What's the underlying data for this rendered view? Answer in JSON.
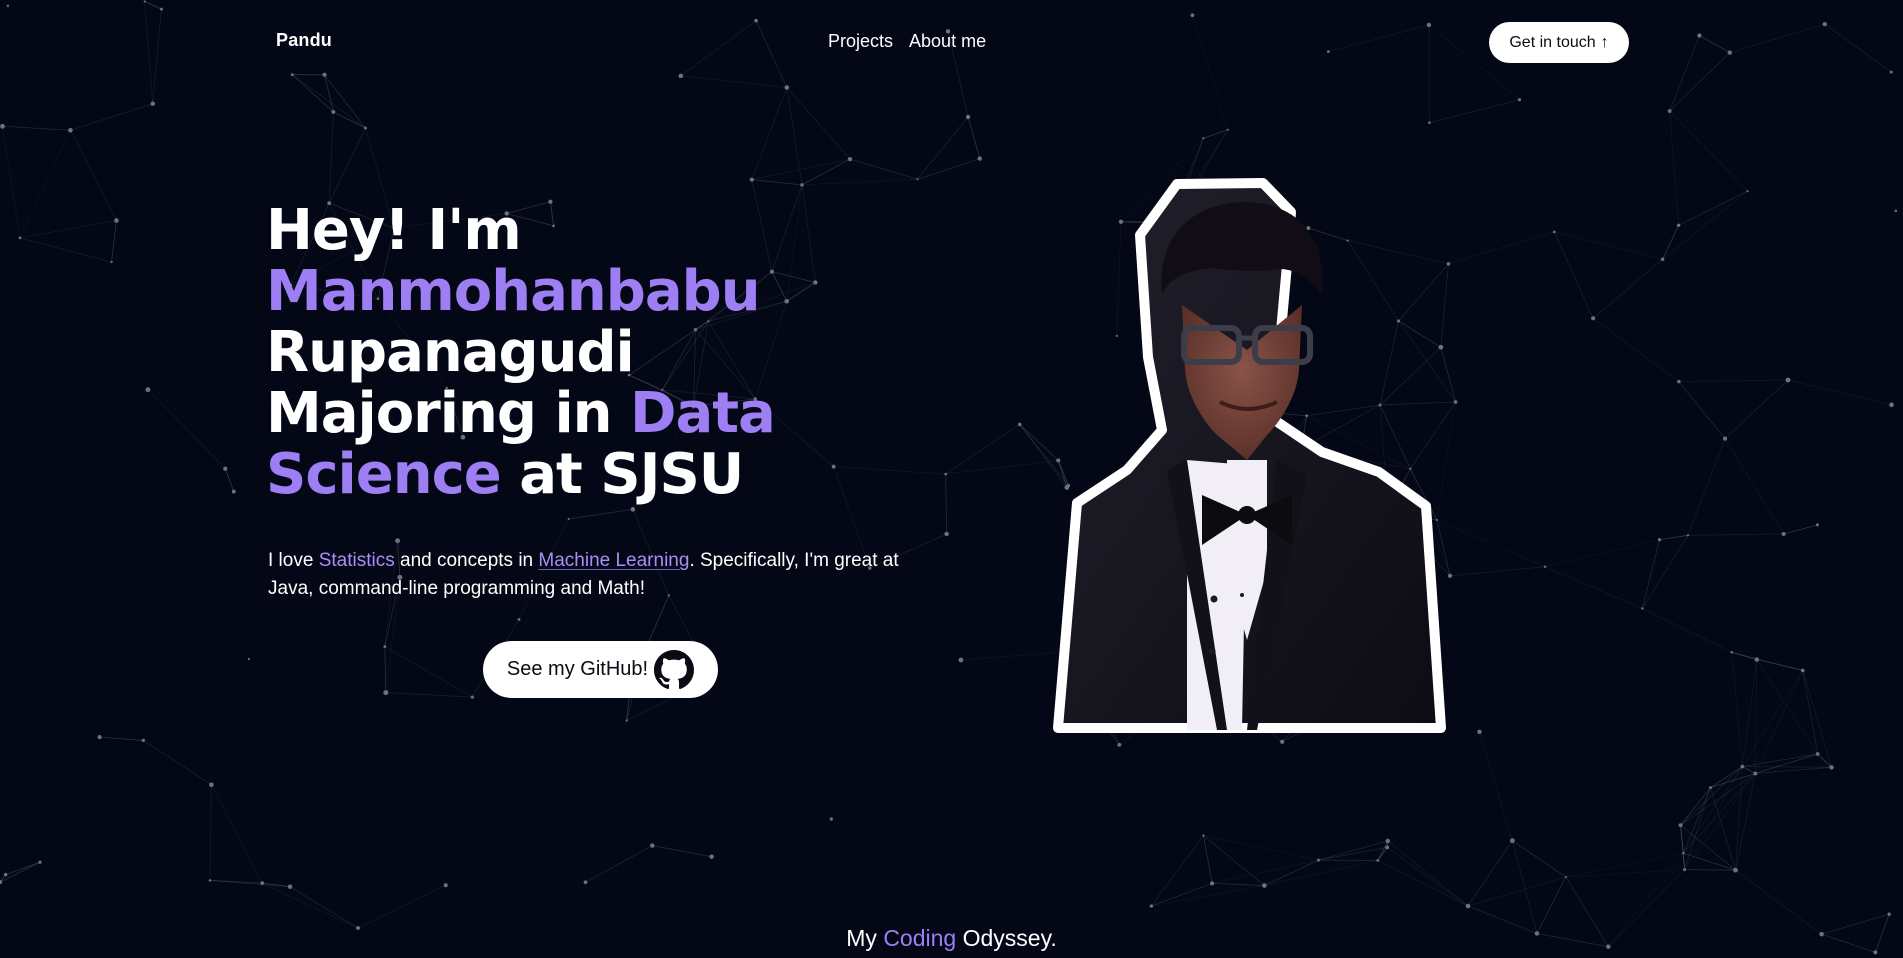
{
  "nav": {
    "logo": "Pandu",
    "links": [
      "Projects",
      "About me"
    ],
    "cta_label": "Get in touch",
    "cta_icon": "arrow-up-icon"
  },
  "hero": {
    "title": {
      "line1": "Hey! I'm",
      "name_first": "Manmohanbabu",
      "name_last": "Rupanagudi",
      "major_prefix": "Majoring in ",
      "major_hl_1": "Data",
      "major_hl_2": "Science",
      "major_suffix": " at SJSU"
    },
    "desc": {
      "p1": "I love ",
      "hl1": "Statistics",
      "p2": " and concepts in ",
      "hl2": "Machine Learning",
      "p3": ". Specifically, I'm great at",
      "p4": "Java, command-line programming and Math!"
    },
    "github_label": "See my GitHub!",
    "github_icon": "github-icon"
  },
  "section": {
    "p1": "My ",
    "hl": "Coding",
    "p2": " Odyssey."
  },
  "colors": {
    "background": "#040816",
    "accent": "#9d7ef3",
    "text": "#ffffff",
    "button_bg": "#ffffff"
  }
}
